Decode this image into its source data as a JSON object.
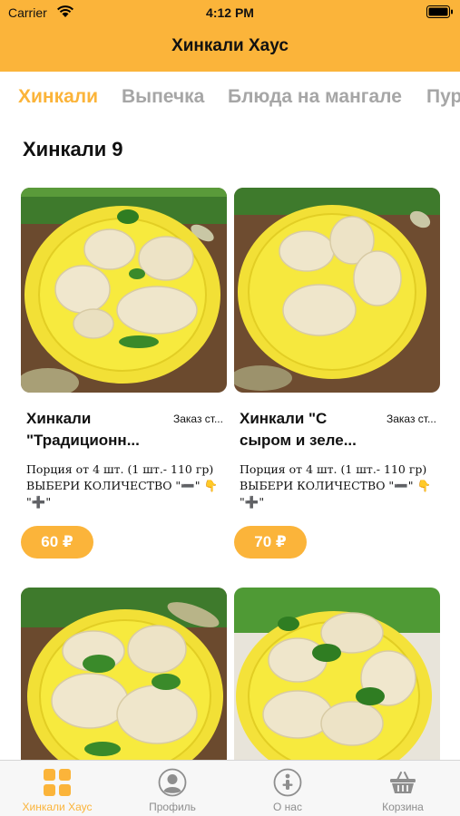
{
  "status_bar": {
    "carrier": "Carrier",
    "time": "4:12 PM"
  },
  "nav": {
    "title": "Хинкали Хаус"
  },
  "categories": [
    "Хинкали",
    "Выпечка",
    "Блюда на мангале",
    "Пур"
  ],
  "active_category": "Хинкали",
  "section": {
    "title": "Хинкали",
    "count": "9"
  },
  "products": [
    {
      "name": "Хинкали \"Традиционн...",
      "pickup": "Заказ ст...",
      "description": "Порция от 4 шт. (1 шт.- 110 гр) ВЫБЕРИ КОЛИЧЕСТВО \"➖\" 👇 \"➕\"",
      "price": "60 ₽"
    },
    {
      "name": "Хинкали \"С сыром и зеле...",
      "pickup": "Заказ ст...",
      "description": "Порция от 4 шт. (1 шт.- 110 гр) ВЫБЕРИ КОЛИЧЕСТВО \"➖\" 👇 \"➕\"",
      "price": "70 ₽"
    },
    {
      "name": "",
      "pickup": "",
      "description": "",
      "price": ""
    },
    {
      "name": "",
      "pickup": "",
      "description": "",
      "price": ""
    }
  ],
  "tabbar": [
    {
      "label": "Хинкали Хаус",
      "icon": "grid-icon",
      "active": true
    },
    {
      "label": "Профиль",
      "icon": "profile-icon",
      "active": false
    },
    {
      "label": "О нас",
      "icon": "info-icon",
      "active": false
    },
    {
      "label": "Корзина",
      "icon": "basket-icon",
      "active": false
    }
  ],
  "colors": {
    "accent": "#FBB43A",
    "inactive_tab": "#A6A6A6",
    "plate": "#F2E036",
    "dough": "#EFE6CB"
  }
}
